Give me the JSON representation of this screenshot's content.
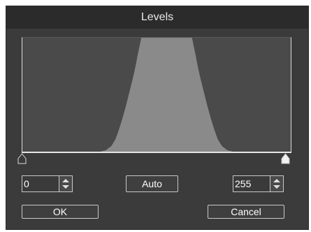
{
  "dialog": {
    "title": "Levels"
  },
  "histogram": {
    "fill_color": "#8a8a8a",
    "background_color": "#4a4a4a"
  },
  "levels": {
    "input_min": "0",
    "input_max": "255"
  },
  "buttons": {
    "auto_label": "Auto",
    "ok_label": "OK",
    "cancel_label": "Cancel"
  },
  "icons": {
    "black_point": "triangle-slider-handle",
    "white_point": "triangle-slider-handle",
    "spinner": "up-down-arrows-icon"
  }
}
